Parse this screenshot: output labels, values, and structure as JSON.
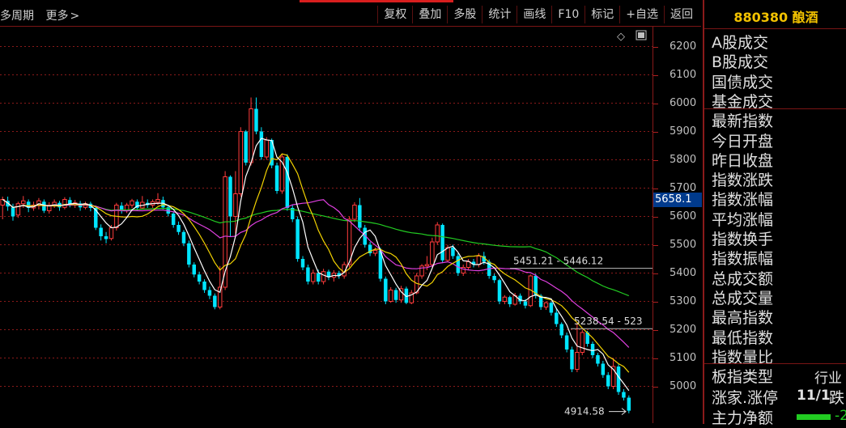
{
  "toolbar": {
    "period_label": "多周期",
    "more_label": "更多",
    "more_chevron": "chevron-right-icon",
    "buttons": [
      "复权",
      "叠加",
      "多股",
      "统计",
      "画线",
      "F10",
      "标记",
      "+自选",
      "返回"
    ]
  },
  "chart_data": {
    "type": "candlestick",
    "y_ticks": [
      6200,
      6100,
      6000,
      5900,
      5800,
      5700,
      5600,
      5500,
      5400,
      5300,
      5200,
      5100,
      5000
    ],
    "ylim": [
      4870,
      6270
    ],
    "current_value": "5658.1",
    "annotations": [
      "5451.21 - 5446.12",
      "5238.54 - 523",
      "4914.58"
    ],
    "colors": {
      "up": "#ff3c3c",
      "down": "#00e5ff",
      "ma5": "#ffffff",
      "ma10": "#f2d200",
      "ma20": "#e040e0",
      "ma60": "#22cc22"
    },
    "candles": [
      [
        5640,
        5660,
        5590,
        5670
      ],
      [
        5655,
        5635,
        5620,
        5670
      ],
      [
        5632,
        5600,
        5585,
        5645
      ],
      [
        5605,
        5645,
        5595,
        5652
      ],
      [
        5645,
        5655,
        5630,
        5672
      ],
      [
        5652,
        5630,
        5615,
        5660
      ],
      [
        5630,
        5640,
        5620,
        5652
      ],
      [
        5638,
        5655,
        5625,
        5665
      ],
      [
        5652,
        5620,
        5612,
        5660
      ],
      [
        5620,
        5640,
        5610,
        5650
      ],
      [
        5640,
        5650,
        5630,
        5660
      ],
      [
        5648,
        5632,
        5620,
        5655
      ],
      [
        5632,
        5660,
        5625,
        5668
      ],
      [
        5658,
        5640,
        5632,
        5668
      ],
      [
        5640,
        5648,
        5630,
        5658
      ],
      [
        5646,
        5632,
        5620,
        5655
      ],
      [
        5632,
        5645,
        5625,
        5652
      ],
      [
        5645,
        5630,
        5618,
        5652
      ],
      [
        5630,
        5560,
        5552,
        5638
      ],
      [
        5560,
        5530,
        5515,
        5572
      ],
      [
        5530,
        5520,
        5505,
        5545
      ],
      [
        5522,
        5560,
        5515,
        5570
      ],
      [
        5560,
        5640,
        5550,
        5648
      ],
      [
        5638,
        5620,
        5610,
        5650
      ],
      [
        5620,
        5640,
        5612,
        5648
      ],
      [
        5640,
        5655,
        5630,
        5662
      ],
      [
        5652,
        5630,
        5622,
        5660
      ],
      [
        5630,
        5650,
        5625,
        5672
      ],
      [
        5648,
        5640,
        5630,
        5660
      ],
      [
        5640,
        5652,
        5630,
        5660
      ],
      [
        5650,
        5660,
        5640,
        5682
      ],
      [
        5658,
        5632,
        5625,
        5670
      ],
      [
        5632,
        5610,
        5600,
        5640
      ],
      [
        5610,
        5570,
        5560,
        5618
      ],
      [
        5570,
        5545,
        5535,
        5582
      ],
      [
        5545,
        5505,
        5495,
        5552
      ],
      [
        5505,
        5430,
        5420,
        5515
      ],
      [
        5430,
        5395,
        5385,
        5438
      ],
      [
        5395,
        5370,
        5360,
        5405
      ],
      [
        5370,
        5340,
        5330,
        5378
      ],
      [
        5340,
        5320,
        5308,
        5352
      ],
      [
        5320,
        5280,
        5272,
        5328
      ],
      [
        5280,
        5350,
        5272,
        5425
      ],
      [
        5350,
        5740,
        5340,
        5760
      ],
      [
        5740,
        5600,
        5530,
        5745
      ],
      [
        5600,
        5680,
        5540,
        5760
      ],
      [
        5680,
        5900,
        5670,
        5915
      ],
      [
        5900,
        5790,
        5780,
        5905
      ],
      [
        5790,
        5980,
        5780,
        6020
      ],
      [
        5980,
        5900,
        5890,
        6020
      ],
      [
        5900,
        5810,
        5800,
        5915
      ],
      [
        5810,
        5870,
        5800,
        5880
      ],
      [
        5870,
        5780,
        5770,
        5875
      ],
      [
        5780,
        5690,
        5680,
        5790
      ],
      [
        5690,
        5810,
        5680,
        5822
      ],
      [
        5810,
        5630,
        5620,
        5820
      ],
      [
        5630,
        5590,
        5580,
        5640
      ],
      [
        5590,
        5450,
        5440,
        5600
      ],
      [
        5450,
        5420,
        5410,
        5460
      ],
      [
        5420,
        5370,
        5360,
        5430
      ],
      [
        5370,
        5400,
        5360,
        5412
      ],
      [
        5400,
        5370,
        5360,
        5412
      ],
      [
        5370,
        5405,
        5360,
        5415
      ],
      [
        5405,
        5385,
        5375,
        5412
      ],
      [
        5385,
        5400,
        5370,
        5410
      ],
      [
        5400,
        5390,
        5380,
        5408
      ],
      [
        5390,
        5430,
        5380,
        5440
      ],
      [
        5430,
        5590,
        5420,
        5600
      ],
      [
        5590,
        5640,
        5580,
        5650
      ],
      [
        5640,
        5560,
        5550,
        5665
      ],
      [
        5560,
        5500,
        5490,
        5570
      ],
      [
        5500,
        5470,
        5460,
        5510
      ],
      [
        5470,
        5480,
        5460,
        5490
      ],
      [
        5480,
        5380,
        5370,
        5490
      ],
      [
        5380,
        5300,
        5290,
        5388
      ],
      [
        5300,
        5340,
        5295,
        5350
      ],
      [
        5340,
        5305,
        5295,
        5348
      ],
      [
        5305,
        5345,
        5295,
        5355
      ],
      [
        5345,
        5295,
        5290,
        5352
      ],
      [
        5295,
        5330,
        5290,
        5340
      ],
      [
        5330,
        5390,
        5325,
        5400
      ],
      [
        5390,
        5425,
        5380,
        5432
      ],
      [
        5425,
        5430,
        5410,
        5460
      ],
      [
        5430,
        5510,
        5420,
        5525
      ],
      [
        5510,
        5570,
        5500,
        5580
      ],
      [
        5570,
        5445,
        5435,
        5575
      ],
      [
        5445,
        5490,
        5440,
        5500
      ],
      [
        5490,
        5460,
        5450,
        5500
      ],
      [
        5460,
        5400,
        5390,
        5470
      ],
      [
        5400,
        5420,
        5390,
        5430
      ],
      [
        5420,
        5440,
        5410,
        5450
      ],
      [
        5440,
        5430,
        5420,
        5450
      ],
      [
        5430,
        5460,
        5420,
        5470
      ],
      [
        5460,
        5440,
        5430,
        5475
      ],
      [
        5440,
        5390,
        5380,
        5448
      ],
      [
        5390,
        5375,
        5365,
        5398
      ],
      [
        5375,
        5300,
        5290,
        5380
      ],
      [
        5300,
        5315,
        5290,
        5322
      ],
      [
        5315,
        5290,
        5280,
        5320
      ],
      [
        5290,
        5320,
        5285,
        5330
      ],
      [
        5320,
        5300,
        5290,
        5328
      ],
      [
        5300,
        5285,
        5275,
        5308
      ],
      [
        5285,
        5390,
        5280,
        5395
      ],
      [
        5390,
        5320,
        5310,
        5398
      ],
      [
        5320,
        5280,
        5270,
        5326
      ],
      [
        5280,
        5295,
        5270,
        5300
      ],
      [
        5295,
        5260,
        5250,
        5300
      ],
      [
        5260,
        5220,
        5210,
        5275
      ],
      [
        5220,
        5180,
        5170,
        5226
      ],
      [
        5180,
        5130,
        5120,
        5190
      ],
      [
        5130,
        5060,
        5050,
        5140
      ],
      [
        5060,
        5120,
        5050,
        5225
      ],
      [
        5120,
        5190,
        5110,
        5200
      ],
      [
        5190,
        5150,
        5140,
        5196
      ],
      [
        5150,
        5110,
        5100,
        5158
      ],
      [
        5110,
        5080,
        5070,
        5118
      ],
      [
        5080,
        5040,
        5030,
        5090
      ],
      [
        5040,
        5000,
        4990,
        5050
      ],
      [
        5000,
        5070,
        4990,
        5100
      ],
      [
        5070,
        4980,
        4970,
        5078
      ],
      [
        4980,
        4960,
        4950,
        4990
      ],
      [
        4960,
        4914,
        4905,
        4968
      ]
    ]
  },
  "panel": {
    "title": "880380 酿酒",
    "rows": [
      "A股成交",
      "B股成交",
      "国债成交",
      "基金成交",
      "最新指数",
      "今日开盘",
      "昨日收盘",
      "指数涨跌",
      "指数涨幅",
      "平均涨幅",
      "指数换手",
      "指数振幅",
      "总成交额",
      "总成交量",
      "最高指数",
      "最低指数",
      "指数量比"
    ],
    "board_type_label": "板指类型",
    "board_type_value": "行业",
    "advance_label": "涨家.涨停",
    "advance_value": "11/1",
    "decline_label": "跌",
    "flow_label": "主力净额",
    "flow_value": "-2",
    "flow_color": "#22cc22"
  }
}
